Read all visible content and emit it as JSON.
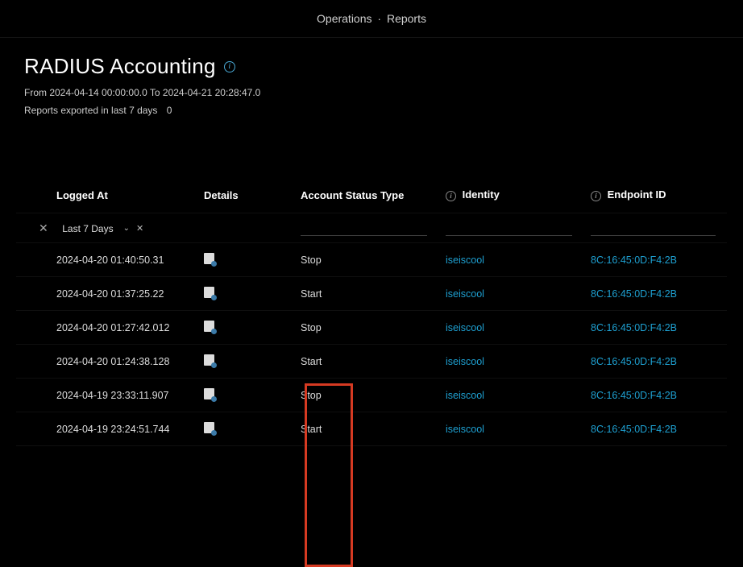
{
  "breadcrumb": {
    "section": "Operations",
    "page": "Reports"
  },
  "header": {
    "title": "RADIUS Accounting",
    "date_range": "From 2024-04-14 00:00:00.0 To 2024-04-21 20:28:47.0",
    "exported_label": "Reports exported in last 7 days",
    "exported_count": "0"
  },
  "columns": {
    "logged_at": "Logged At",
    "details": "Details",
    "status": "Account Status Type",
    "identity": "Identity",
    "endpoint": "Endpoint ID"
  },
  "filter": {
    "range_label": "Last 7 Days"
  },
  "rows": [
    {
      "logged_at": "2024-04-20 01:40:50.31",
      "status": "Stop",
      "identity": "iseiscool",
      "endpoint": "8C:16:45:0D:F4:2B"
    },
    {
      "logged_at": "2024-04-20 01:37:25.22",
      "status": "Start",
      "identity": "iseiscool",
      "endpoint": "8C:16:45:0D:F4:2B"
    },
    {
      "logged_at": "2024-04-20 01:27:42.012",
      "status": "Stop",
      "identity": "iseiscool",
      "endpoint": "8C:16:45:0D:F4:2B"
    },
    {
      "logged_at": "2024-04-20 01:24:38.128",
      "status": "Start",
      "identity": "iseiscool",
      "endpoint": "8C:16:45:0D:F4:2B"
    },
    {
      "logged_at": "2024-04-19 23:33:11.907",
      "status": "Stop",
      "identity": "iseiscool",
      "endpoint": "8C:16:45:0D:F4:2B"
    },
    {
      "logged_at": "2024-04-19 23:24:51.744",
      "status": "Start",
      "identity": "iseiscool",
      "endpoint": "8C:16:45:0D:F4:2B"
    }
  ]
}
